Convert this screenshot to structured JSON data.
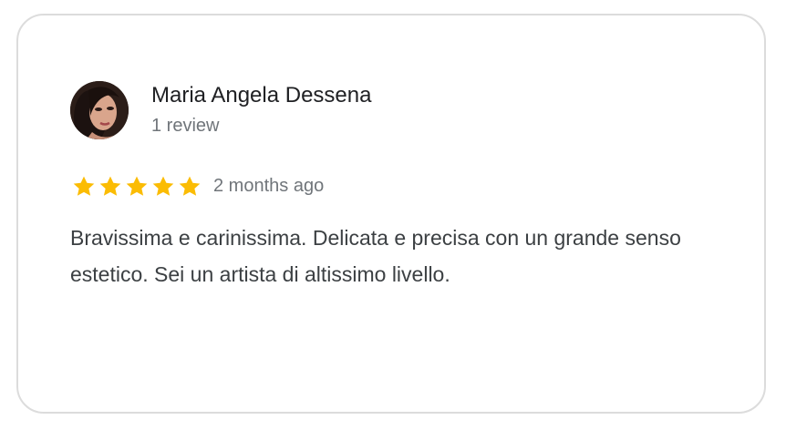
{
  "review": {
    "author_name": "Maria Angela Dessena",
    "review_count": "1 review",
    "rating": 5,
    "rating_max": 5,
    "star_color": "#fbbc04",
    "timestamp": "2 months ago",
    "text": "Bravissima e carinissima. Delicata e precisa con un grande senso estetico. Sei un artista di altissimo livello."
  },
  "icons": {
    "avatar": "profile-photo",
    "star": "star-icon"
  }
}
